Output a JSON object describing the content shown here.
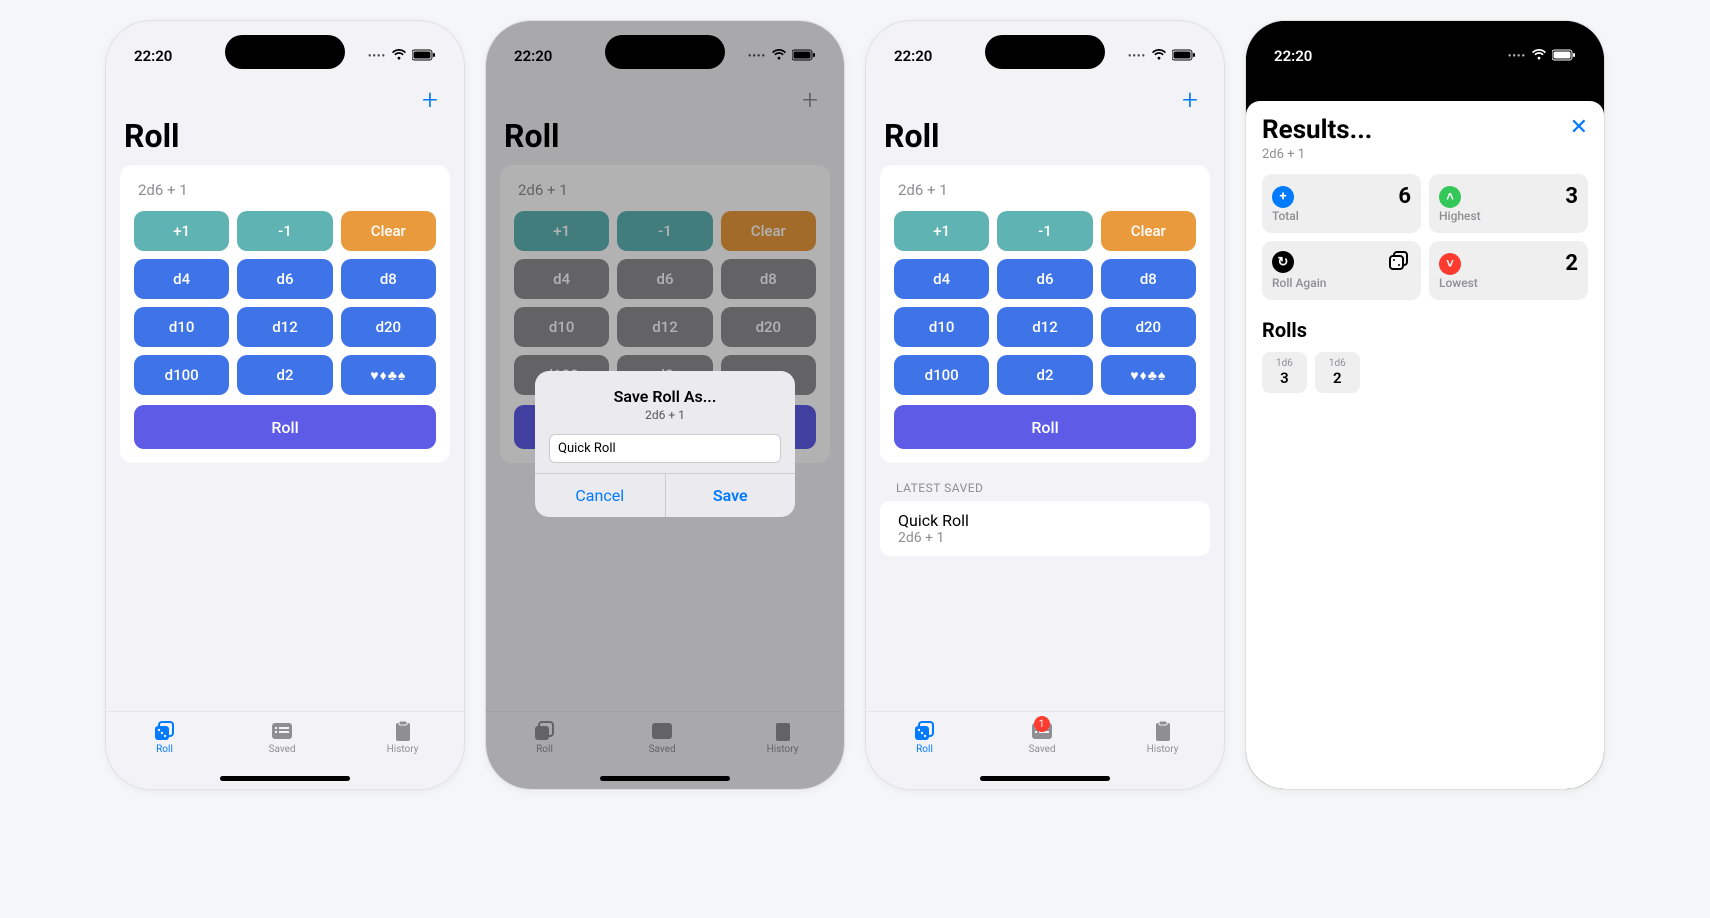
{
  "status": {
    "time": "22:20"
  },
  "common": {
    "title": "Roll",
    "formula": "2d6 + 1",
    "buttons": {
      "plus1": "+1",
      "minus1": "-1",
      "clear": "Clear",
      "d4": "d4",
      "d6": "d6",
      "d8": "d8",
      "d10": "d10",
      "d12": "d12",
      "d20": "d20",
      "d100": "d100",
      "d2": "d2",
      "suits": "♥♦♣♠",
      "roll": "Roll"
    },
    "tabs": {
      "roll": "Roll",
      "saved": "Saved",
      "history": "History"
    }
  },
  "alert": {
    "title": "Save Roll As...",
    "subtitle": "2d6 + 1",
    "input_value": "Quick Roll",
    "cancel": "Cancel",
    "save": "Save"
  },
  "saved_section": {
    "header": "LATEST SAVED",
    "row_title": "Quick Roll",
    "row_sub": "2d6 + 1",
    "badge": "1"
  },
  "results": {
    "title": "Results...",
    "formula": "2d6 + 1",
    "total": {
      "label": "Total",
      "value": "6"
    },
    "highest": {
      "label": "Highest",
      "value": "3"
    },
    "lowest": {
      "label": "Lowest",
      "value": "2"
    },
    "roll_again": {
      "label": "Roll Again"
    },
    "rolls_heading": "Rolls",
    "rolls": [
      {
        "label": "1d6",
        "value": "3"
      },
      {
        "label": "1d6",
        "value": "2"
      }
    ]
  }
}
